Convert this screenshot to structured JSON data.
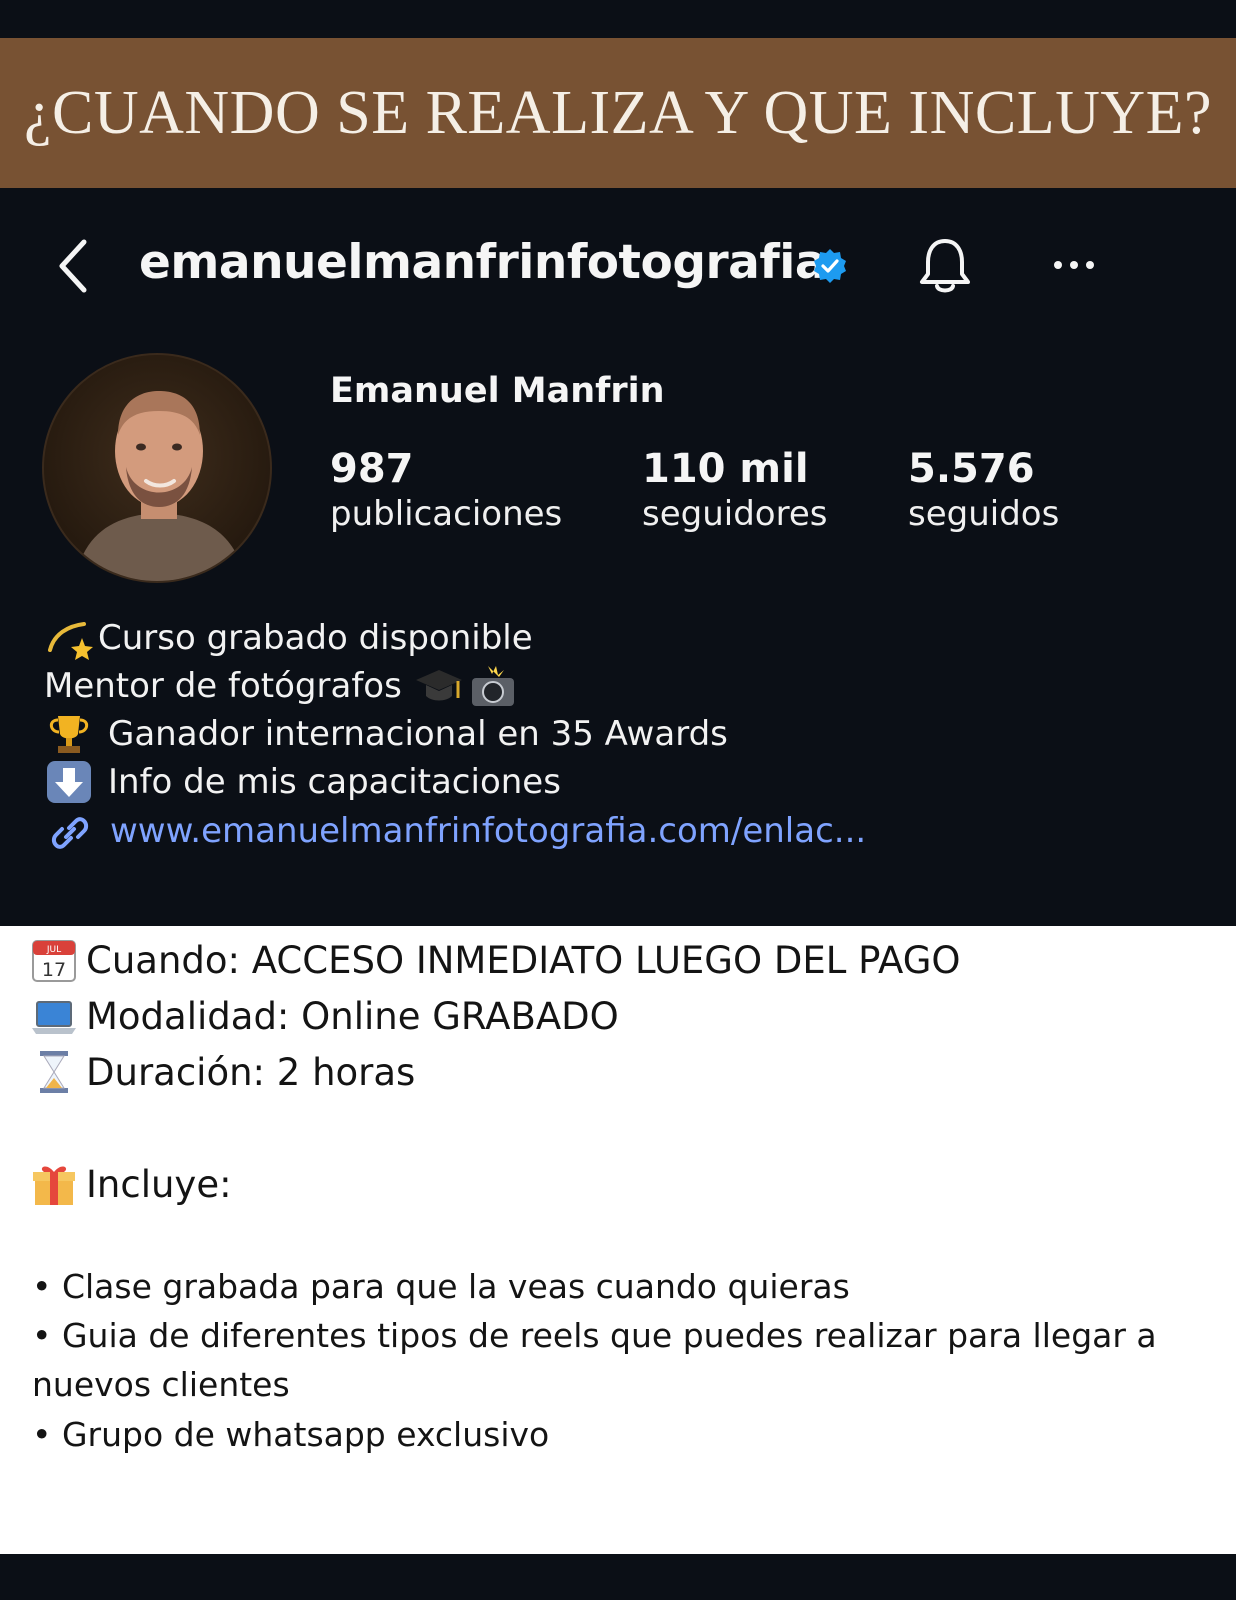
{
  "banner": {
    "title": "¿CUANDO SE REALIZA Y QUE INCLUYE?"
  },
  "header": {
    "username": "emanuelmanfrinfotografia",
    "icons": [
      "back-icon",
      "verified-icon",
      "bell-icon",
      "more-icon"
    ]
  },
  "profile": {
    "full_name": "Emanuel Manfrin",
    "stats": [
      {
        "value": "987",
        "label": "publicaciones"
      },
      {
        "value": "110 mil",
        "label": "seguidores"
      },
      {
        "value": "5.576",
        "label": "seguidos"
      }
    ],
    "bio": [
      {
        "icon": "dizzy-star-icon",
        "text": "Curso grabado disponible"
      },
      {
        "icon": "",
        "text": "Mentor de fotógrafos"
      },
      {
        "icon": "trophy-icon",
        "text": "Ganador internacional en 35 Awards"
      },
      {
        "icon": "down-arrow-icon",
        "text": "Info de mis capacitaciones"
      }
    ],
    "bio_trailing_icons": [
      "graduation-cap-icon",
      "camera-flash-icon"
    ],
    "link": {
      "icon": "link-icon",
      "text": "www.emanuelmanfrinfotografia.com/enlac..."
    }
  },
  "details": {
    "when": {
      "icon": "calendar-icon",
      "text": "Cuando: ACCESO INMEDIATO LUEGO DEL PAGO",
      "calendar_month": "JUL",
      "calendar_day": "17"
    },
    "mode": {
      "icon": "laptop-icon",
      "text": "Modalidad: Online GRABADO"
    },
    "duration": {
      "icon": "hourglass-icon",
      "text": "Duración: 2 horas"
    },
    "includes": {
      "icon": "gift-icon",
      "text": "Incluye:"
    },
    "bullets": [
      "• Clase grabada para que la veas cuando quieras",
      "• Guia de diferentes tipos de reels que puedes realizar para llegar a",
      "nuevos clientes",
      "• Grupo de whatsapp exclusivo"
    ]
  },
  "colors": {
    "banner": "#785233",
    "background_dark": "#0b0f16",
    "link": "#7fa3ff",
    "verified": "#1d9bf0"
  }
}
